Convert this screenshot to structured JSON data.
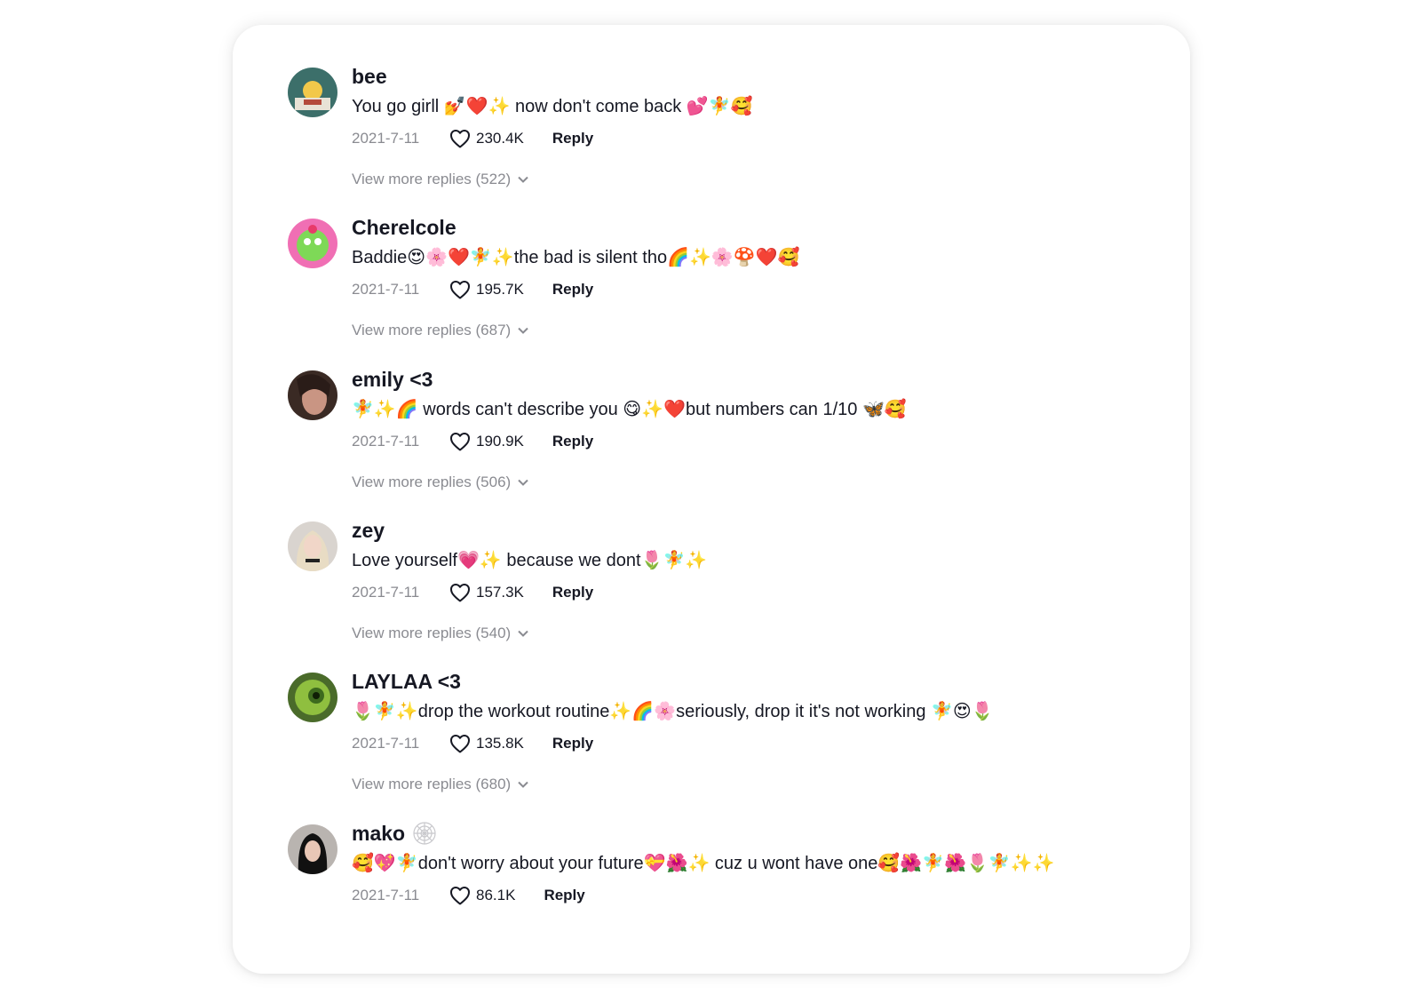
{
  "comments": [
    {
      "username": "bee",
      "text": "You go girll 💅❤️✨ now don't come back 💕🧚🥰",
      "date": "2021-7-11",
      "likes": "230.4K",
      "reply_label": "Reply",
      "more_replies": "View more replies (522)"
    },
    {
      "username": "Cherelcole",
      "text": "Baddie😍🌸❤️🧚✨the bad is silent tho🌈✨🌸🍄❤️🥰",
      "date": "2021-7-11",
      "likes": "195.7K",
      "reply_label": "Reply",
      "more_replies": "View more replies (687)"
    },
    {
      "username": "emily <3",
      "text": "🧚✨🌈 words can't describe you 😋✨❤️but numbers can 1/10 🦋🥰",
      "date": "2021-7-11",
      "likes": "190.9K",
      "reply_label": "Reply",
      "more_replies": "View more replies (506)"
    },
    {
      "username": "zey",
      "text": "Love yourself💗✨ because we dont🌷🧚✨",
      "date": "2021-7-11",
      "likes": "157.3K",
      "reply_label": "Reply",
      "more_replies": "View more replies (540)"
    },
    {
      "username": "LAYLAA <3",
      "text": "🌷🧚✨drop the workout routine✨🌈🌸seriously, drop it it's not working 🧚😍🌷",
      "date": "2021-7-11",
      "likes": "135.8K",
      "reply_label": "Reply",
      "more_replies": "View more replies (680)"
    },
    {
      "username": "mako",
      "text": "🥰💖🧚don't worry about your future💝🌺✨ cuz u wont have one🥰🌺🧚🌺🌷🧚✨✨",
      "date": "2021-7-11",
      "likes": "86.1K",
      "reply_label": "Reply",
      "more_replies": ""
    }
  ],
  "icons": {
    "like": "heart-outline-icon",
    "expand": "chevron-down-icon",
    "username_badge": "spiderweb-icon"
  },
  "colors": {
    "text_primary": "#161823",
    "text_secondary": "#8a8b91",
    "card_background": "#ffffff"
  }
}
